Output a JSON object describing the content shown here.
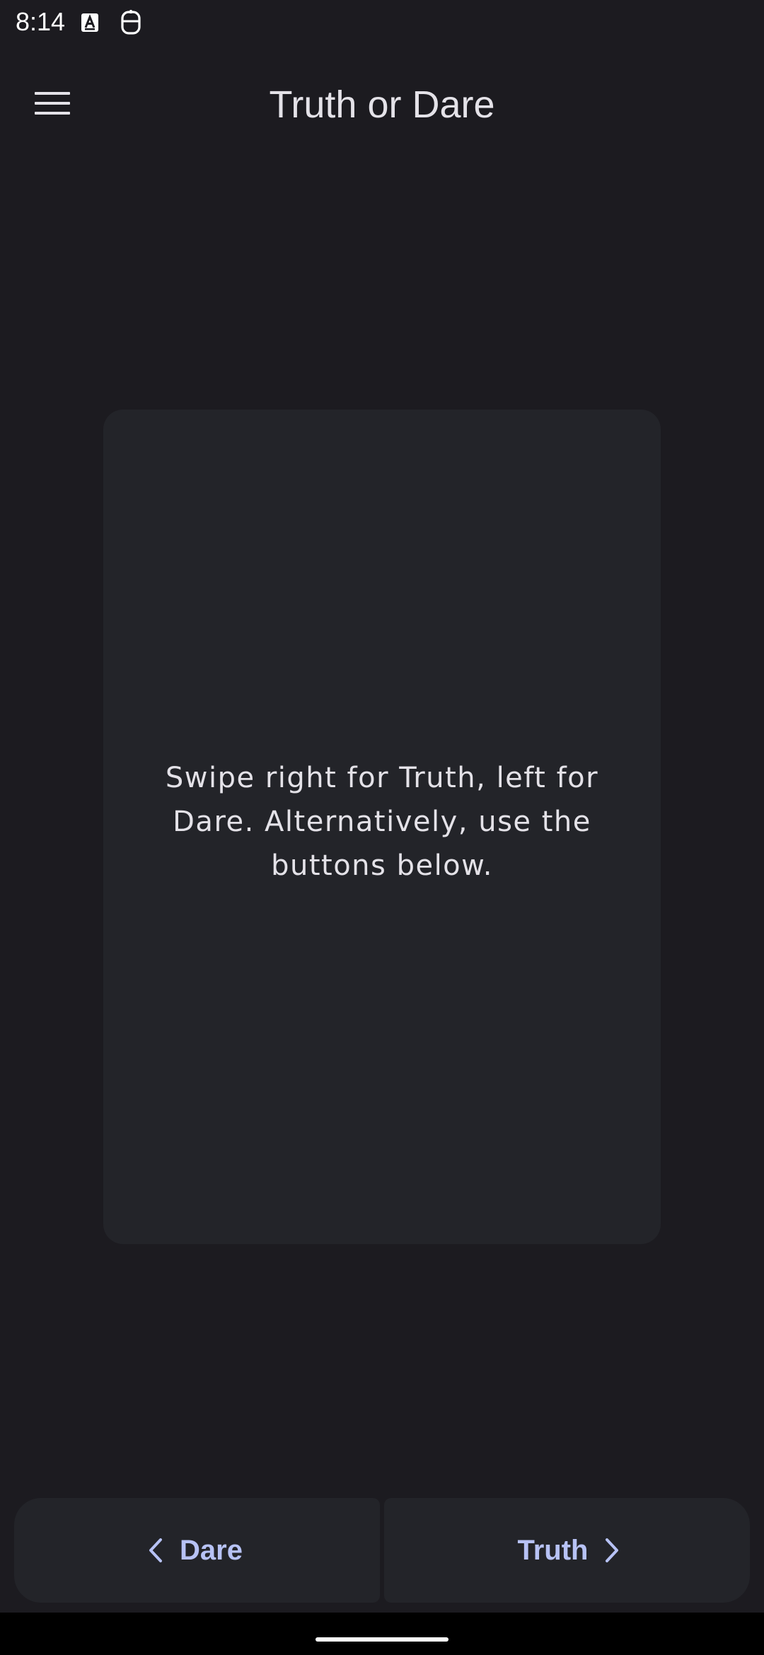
{
  "status_bar": {
    "time": "8:14",
    "icons": [
      "a-badge-icon",
      "face-icon"
    ]
  },
  "app_bar": {
    "title": "Truth or Dare",
    "menu_icon": "hamburger-menu-icon"
  },
  "card": {
    "text": "Swipe right for Truth, left for Dare. Alternatively, use the buttons below."
  },
  "bottom_buttons": {
    "dare_label": "Dare",
    "dare_icon": "chevron-left-icon",
    "truth_label": "Truth",
    "truth_icon": "chevron-right-icon"
  },
  "colors": {
    "background": "#1c1b20",
    "card": "#232429",
    "accent": "#b7c2f5",
    "text": "#e4e2e8"
  }
}
